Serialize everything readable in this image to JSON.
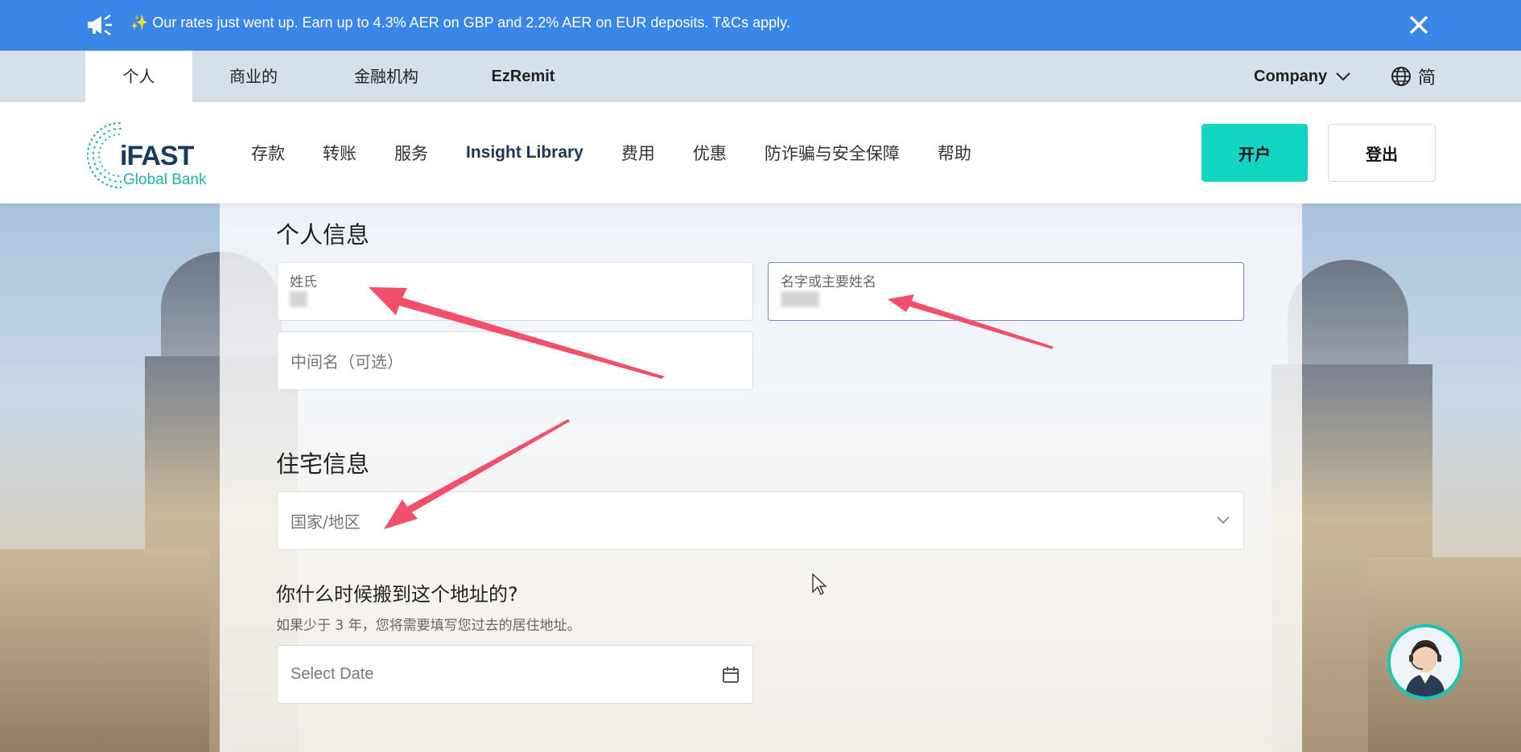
{
  "banner": {
    "text": "✨ Our rates just went up. Earn up to 4.3% AER on GBP and 2.2% AER on EUR deposits. T&Cs apply."
  },
  "segments": [
    {
      "label": "个人"
    },
    {
      "label": "商业的"
    },
    {
      "label": "金融机构"
    },
    {
      "label": "EzRemit"
    }
  ],
  "company_label": "Company",
  "lang_label": "简",
  "logo": {
    "word": "iFAST",
    "sub": "Global Bank"
  },
  "nav": [
    {
      "label": "存款"
    },
    {
      "label": "转账"
    },
    {
      "label": "服务"
    },
    {
      "label": "Insight Library"
    },
    {
      "label": "费用"
    },
    {
      "label": "优惠"
    },
    {
      "label": "防诈骗与安全保障"
    },
    {
      "label": "帮助"
    }
  ],
  "buttons": {
    "open": "开户",
    "logout": "登出"
  },
  "form": {
    "personal_title": "个人信息",
    "surname_label": "姓氏",
    "given_label": "名字或主要姓名",
    "middle_placeholder": "中间名（可选）",
    "residence_title": "住宅信息",
    "country_placeholder": "国家/地区",
    "move_question": "你什么时候搬到这个地址的?",
    "move_hint": "如果少于 3 年，您将需要填写您过去的居住地址。",
    "date_placeholder": "Select Date"
  },
  "colors": {
    "banner": "#3a86e8",
    "accent": "#12d6c2",
    "arrow": "#f2506a"
  }
}
